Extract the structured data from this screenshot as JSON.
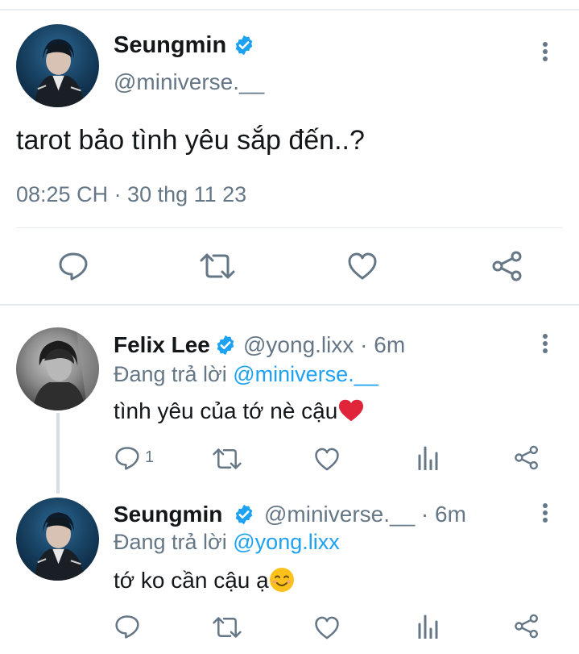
{
  "main_tweet": {
    "name": "Seungmin",
    "handle": "@miniverse.__",
    "text": "tarot bảo tình yêu sắp đến..?",
    "meta": "08:25 CH · 30 thg 11 23"
  },
  "replies": [
    {
      "name": "Felix Lee",
      "handle": "@yong.lixx · 6m",
      "replying_prefix": "Đang trả lời ",
      "replying_to": "@miniverse.__",
      "text": "tình yêu của tớ nè cậu",
      "reply_count": "1"
    },
    {
      "name": "Seungmin",
      "handle": "@miniverse.__ · 6m",
      "replying_prefix": "Đang trả lời ",
      "replying_to": "@yong.lixx",
      "text": "tớ ko cần cậu ạ"
    }
  ],
  "colors": {
    "verified": "#1da1f2",
    "link": "#1da1f2",
    "secondary_text": "#657786",
    "divider": "#e6ecf0"
  },
  "icons": [
    "verified-badge-icon",
    "more-vertical-icon",
    "reply-icon",
    "retweet-icon",
    "like-icon",
    "share-icon",
    "analytics-icon",
    "heart-emoji-icon",
    "smile-emoji-icon"
  ]
}
